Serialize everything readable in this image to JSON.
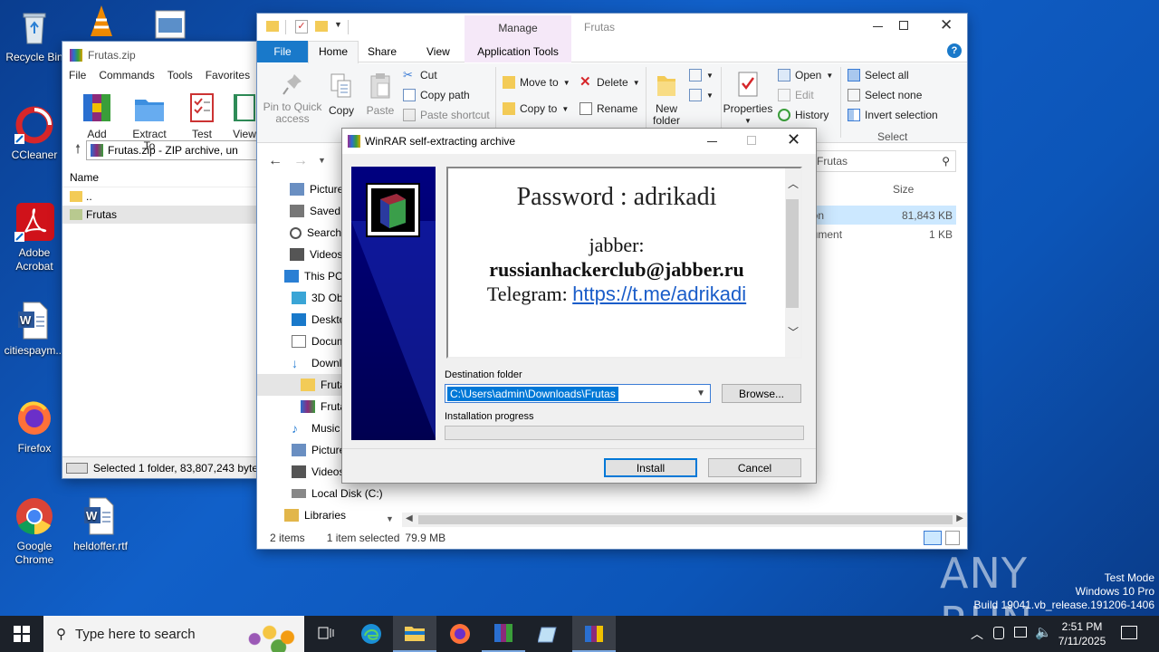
{
  "desktop": {
    "icons": [
      {
        "label": "Recycle Bin"
      },
      {
        "label": "CCleaner"
      },
      {
        "label": "Adobe Acrobat"
      },
      {
        "label": "citiespaym..."
      },
      {
        "label": "Firefox"
      },
      {
        "label": "Google Chrome"
      },
      {
        "label": "heldoffer.rtf"
      }
    ],
    "watermark": {
      "text": "ANY RUN",
      "line1": "Test Mode",
      "line2": "Windows 10 Pro",
      "line3": "Build 19041.vb_release.191206-1406"
    }
  },
  "winrar": {
    "title": "Frutas.zip",
    "menu": [
      "File",
      "Commands",
      "Tools",
      "Favorites"
    ],
    "toolbar": [
      "Add",
      "Extract To",
      "Test",
      "View"
    ],
    "path": "Frutas.zip - ZIP archive, un",
    "column_name": "Name",
    "rows": [
      "..",
      "Frutas"
    ],
    "status": "Selected 1 folder, 83,807,243 byte"
  },
  "explorer": {
    "title": "Frutas",
    "manage_label": "Manage",
    "tabs": [
      "File",
      "Home",
      "Share",
      "View",
      "Application Tools"
    ],
    "ribbon": {
      "pin": "Pin to Quick access",
      "copy": "Copy",
      "paste": "Paste",
      "cut": "Cut",
      "copy_path": "Copy path",
      "paste_shortcut": "Paste shortcut",
      "move_to": "Move to",
      "copy_to": "Copy to",
      "delete": "Delete",
      "rename": "Rename",
      "new_folder": "New folder",
      "properties": "Properties",
      "open": "Open",
      "edit": "Edit",
      "history": "History",
      "select_all": "Select all",
      "select_none": "Select none",
      "invert_selection": "Invert selection",
      "select_group": "Select"
    },
    "search_placeholder": "Frutas",
    "col_size": "Size",
    "files": [
      {
        "type": "ation",
        "size": "81,843 KB"
      },
      {
        "type": "ocument",
        "size": "1 KB"
      }
    ],
    "nav": [
      "Pictures",
      "Saved",
      "Search",
      "Videos",
      "This PC",
      "3D Objects",
      "Desktop",
      "Documents",
      "Downloads",
      "Frutas",
      "Frutas",
      "Music",
      "Pictures",
      "Videos",
      "Local Disk (C:)",
      "Libraries"
    ],
    "status_items": "2 items",
    "status_selected": "1 item selected",
    "status_size": "79.9 MB"
  },
  "sfx": {
    "title": "WinRAR self-extracting archive",
    "password_line": "Password : adrikadi",
    "jabber_label": "jabber:",
    "jabber_value": "russianhackerclub@jabber.ru",
    "telegram_label": "Telegram:",
    "telegram_link": "https://t.me/adrikadi",
    "dest_label": "Destination folder",
    "dest_value": "C:\\Users\\admin\\Downloads\\Frutas",
    "browse": "Browse...",
    "progress_label": "Installation progress",
    "progress": 0,
    "install": "Install",
    "cancel": "Cancel"
  },
  "taskbar": {
    "search_placeholder": "Type here to search",
    "time": "2:51 PM",
    "date": "7/11/2025"
  },
  "colors": {
    "accent": "#0078d7",
    "taskbar": "#101820",
    "banner": "#000080"
  }
}
